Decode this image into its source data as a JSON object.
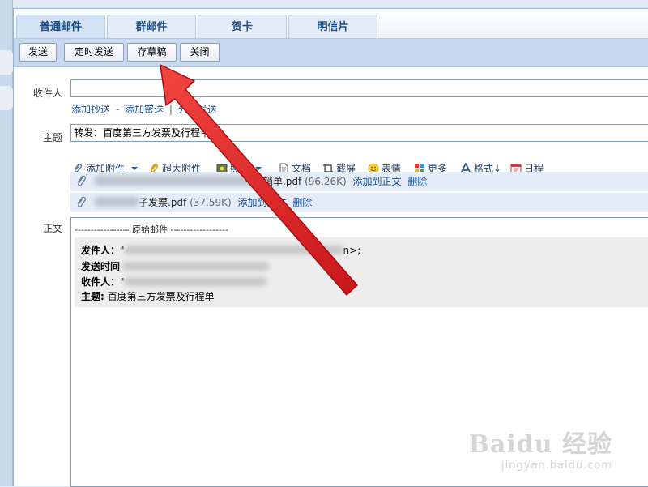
{
  "tabs": [
    {
      "label": "普通邮件"
    },
    {
      "label": "群邮件"
    },
    {
      "label": "贺卡"
    },
    {
      "label": "明信片"
    }
  ],
  "toolbar": {
    "send": "发送",
    "scheduled_send": "定时发送",
    "save_draft": "存草稿",
    "close": "关闭"
  },
  "recipient": {
    "label": "收件人",
    "value": "",
    "add_cc": "添加抄送",
    "add_bcc": "添加密送",
    "separate_send": "分别发送",
    "dash": "-",
    "pipe": "|"
  },
  "subject": {
    "label": "主题",
    "value": "转发：百度第三方发票及行程单"
  },
  "attach_toolbar": {
    "add_attachment": "添加附件",
    "large_attachment": "超大附件",
    "photo": "照片",
    "document": "文档",
    "screenshot": "截屏",
    "emoji": "表情",
    "more": "更多",
    "format": "格式",
    "format_suffix": "↓",
    "schedule": "日程"
  },
  "attachments": [
    {
      "name_visible": "报销单.pdf",
      "size": "(96.26K)",
      "add_to_body": "添加到正文",
      "delete": "删除"
    },
    {
      "name_visible": "子发票.pdf",
      "size": "(37.59K)",
      "add_to_body": "添加到正文",
      "delete": "删除"
    }
  ],
  "body": {
    "label": "正文",
    "separator": "----------------- 原始邮件 ------------------",
    "from_label": "发件人：",
    "from_value_prefix": "\"",
    "from_value_suffix": "n>;",
    "sent_time_label": "发送时间",
    "to_label": "收件人：",
    "to_value_prefix": "\"",
    "subject_label": "主题:",
    "subject_value": "百度第三方发票及行程单"
  },
  "watermark": {
    "main": "Baidu 经验",
    "sub": "jingyan.baidu.com"
  },
  "colors": {
    "accent_link": "#1f4f94",
    "arrow_red": "#e3262b",
    "toolbar_bg": "#c6d9ef"
  }
}
